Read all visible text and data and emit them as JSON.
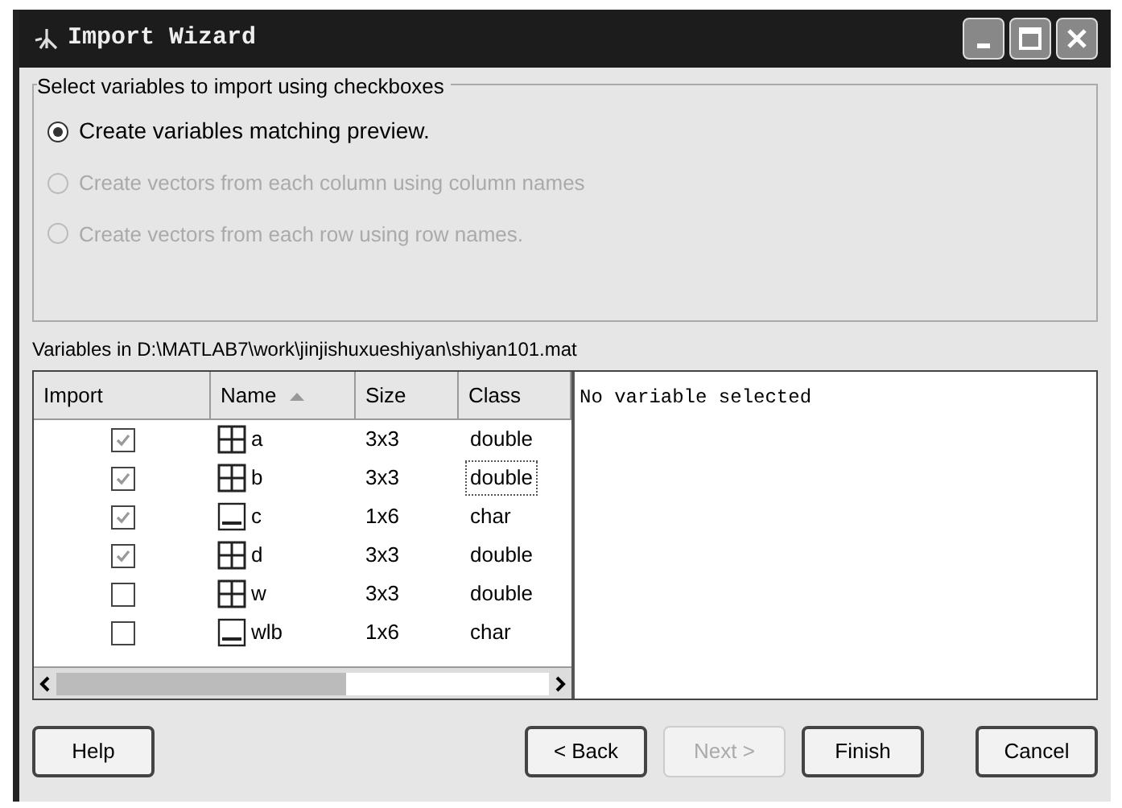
{
  "window": {
    "title": "Import Wizard"
  },
  "group": {
    "title": "Select variables to import using checkboxes",
    "options": [
      {
        "label": "Create variables matching preview.",
        "selected": true,
        "disabled": false
      },
      {
        "label": "Create vectors from each column using column names",
        "selected": false,
        "disabled": true
      },
      {
        "label": "Create vectors from each row using row names.",
        "selected": false,
        "disabled": true
      }
    ]
  },
  "variables_label": "Variables in D:\\MATLAB7\\work\\jinjishuxueshiyan\\shiyan101.mat",
  "table": {
    "columns": [
      {
        "label": "Import",
        "sorted": false
      },
      {
        "label": "Name",
        "sorted": true
      },
      {
        "label": "Size",
        "sorted": false
      },
      {
        "label": "Class",
        "sorted": false
      }
    ],
    "rows": [
      {
        "import": true,
        "kind": "matrix",
        "name": "a",
        "size": "3x3",
        "class": "double",
        "focused": false
      },
      {
        "import": true,
        "kind": "matrix",
        "name": "b",
        "size": "3x3",
        "class": "double",
        "focused": true
      },
      {
        "import": true,
        "kind": "text",
        "name": "c",
        "size": "1x6",
        "class": "char",
        "focused": false
      },
      {
        "import": true,
        "kind": "matrix",
        "name": "d",
        "size": "3x3",
        "class": "double",
        "focused": false
      },
      {
        "import": false,
        "kind": "matrix",
        "name": "w",
        "size": "3x3",
        "class": "double",
        "focused": false
      },
      {
        "import": false,
        "kind": "text",
        "name": "wlb",
        "size": "1x6",
        "class": "char",
        "focused": false
      }
    ]
  },
  "preview": {
    "text": "No variable selected"
  },
  "left_buttons": [
    {
      "label": "Help",
      "disabled": false
    }
  ],
  "right_buttons": [
    {
      "label": "< Back",
      "disabled": false
    },
    {
      "label": "Next >",
      "disabled": true
    },
    {
      "label": "Finish",
      "disabled": false
    },
    {
      "label": "Cancel",
      "disabled": false
    }
  ]
}
